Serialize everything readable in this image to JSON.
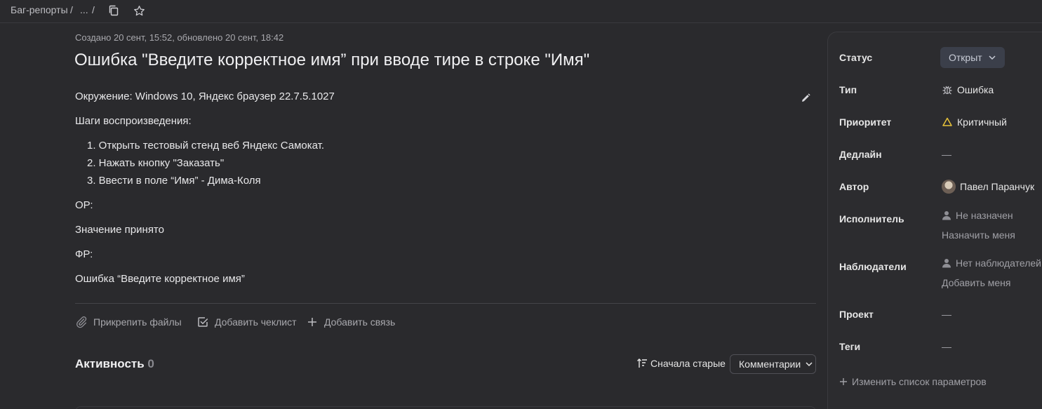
{
  "breadcrumb": {
    "root": "Баг-репорты",
    "sep1": "/",
    "ellipsis": "...",
    "sep2": "/"
  },
  "issue": {
    "meta": "Создано 20 сент, 15:52, обновлено 20 сент, 18:42",
    "title": "Ошибка \"Введите корректное имя” при вводе тире в строке \"Имя\"",
    "environment": "Окружение: Windows 10, Яндекс браузер 22.7.5.1027",
    "steps_heading": "Шаги воспроизведения:",
    "steps": [
      "1. Открыть тестовый стенд веб Яндекс Самокат.",
      "2. Нажать кнопку \"Заказать\"",
      "3. Ввести в поле “Имя” - Дима-Коля"
    ],
    "expected_label": "ОР:",
    "expected_value": "Значение принято",
    "actual_label": "ФР:",
    "actual_value": "Ошибка “Введите корректное имя”"
  },
  "actions": {
    "attach": "Прикрепить файлы",
    "checklist": "Добавить чеклист",
    "link": "Добавить связь"
  },
  "activity": {
    "label": "Активность",
    "count": "0",
    "sort": "Сначала старые",
    "filter": "Комментарии"
  },
  "sidebar": {
    "status_label": "Статус",
    "status_value": "Открыт",
    "type_label": "Тип",
    "type_value": "Ошибка",
    "priority_label": "Приоритет",
    "priority_value": "Критичный",
    "deadline_label": "Дедлайн",
    "deadline_value": "—",
    "author_label": "Автор",
    "author_value": "Павел Паранчук",
    "assignee_label": "Исполнитель",
    "assignee_value": "Не назначен",
    "assign_me": "Назначить меня",
    "watchers_label": "Наблюдатели",
    "watchers_value": "Нет наблюдателей",
    "add_me": "Добавить меня",
    "project_label": "Проект",
    "project_value": "—",
    "tags_label": "Теги",
    "tags_value": "—",
    "edit_params": "Изменить список параметров"
  },
  "colors": {
    "background": "#2a2a2d",
    "priority_triangle": "#e8c33a",
    "status_button": "#3b3f4a"
  }
}
